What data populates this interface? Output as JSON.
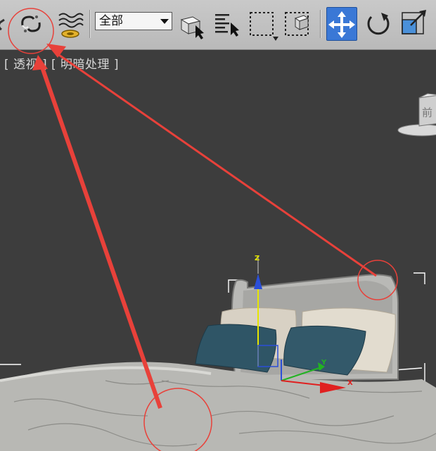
{
  "toolbar": {
    "selection_filter": {
      "selected": "全部"
    },
    "buttons": [
      {
        "name": "unlink-icon"
      },
      {
        "name": "select-and-link-icon"
      },
      {
        "name": "bind-to-space-warp-icon"
      },
      {
        "name": "select-object-icon"
      },
      {
        "name": "select-by-name-icon"
      },
      {
        "name": "rectangular-selection-region-icon"
      },
      {
        "name": "window-crossing-icon"
      },
      {
        "name": "select-and-move-icon",
        "active": true
      },
      {
        "name": "select-and-rotate-icon"
      },
      {
        "name": "select-and-scale-icon"
      }
    ]
  },
  "viewport": {
    "label": "[ 透视 ] [ 明暗处理 ]",
    "gizmo_labels": {
      "z": "Z",
      "y": "Y",
      "x": "X"
    },
    "viewcube_label": "前"
  },
  "annotation_color": "#e8413a",
  "accent_color": "#3a78d6"
}
